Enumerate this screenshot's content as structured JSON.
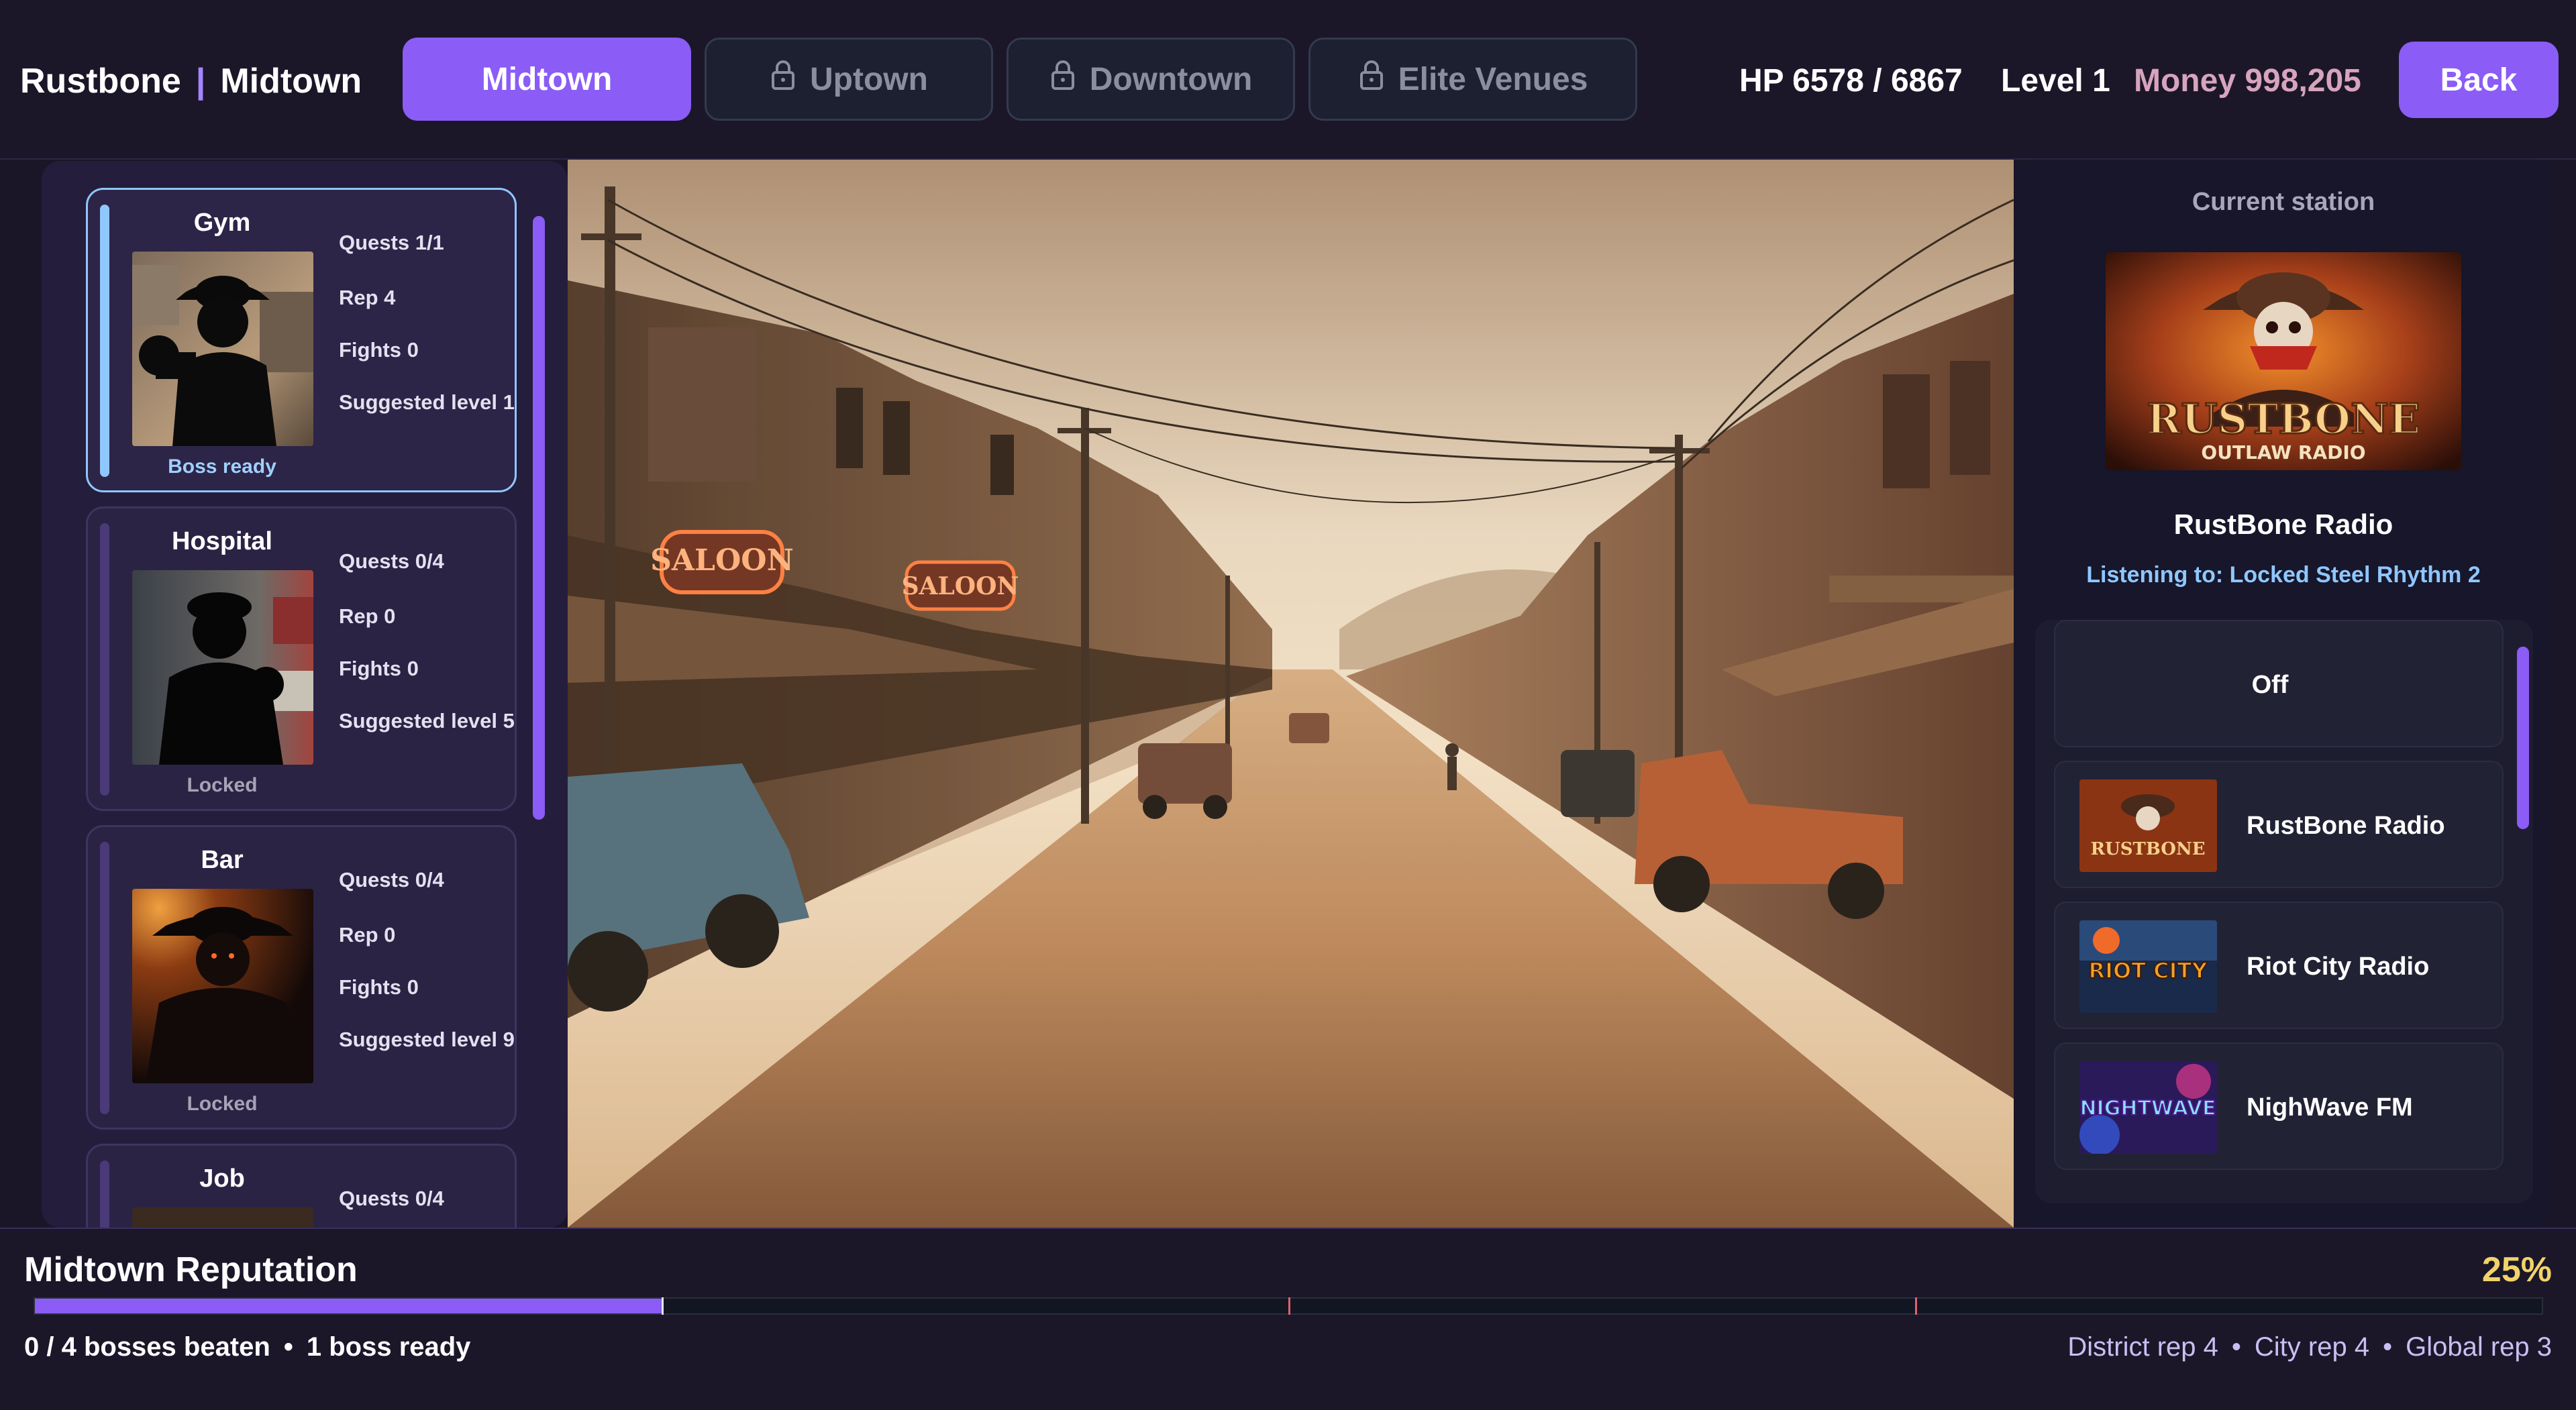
{
  "header": {
    "city": "Rustbone",
    "separator": "|",
    "district": "Midtown",
    "tabs": [
      {
        "label": "Midtown",
        "locked": false
      },
      {
        "label": "Uptown",
        "locked": true
      },
      {
        "label": "Downtown",
        "locked": true
      },
      {
        "label": "Elite Venues",
        "locked": true
      }
    ],
    "hp": "HP 6578 / 6867",
    "level": "Level 1",
    "money": "Money 998,205",
    "back_label": "Back"
  },
  "locations": [
    {
      "name": "Gym",
      "quests": "Quests 1/1",
      "rep": "Rep 4",
      "fights": "Fights 0",
      "suggested": "Suggested level 1",
      "status": "Boss ready",
      "selected": true
    },
    {
      "name": "Hospital",
      "quests": "Quests 0/4",
      "rep": "Rep 0",
      "fights": "Fights 0",
      "suggested": "Suggested level 5",
      "status": "Locked",
      "selected": false
    },
    {
      "name": "Bar",
      "quests": "Quests 0/4",
      "rep": "Rep 0",
      "fights": "Fights 0",
      "suggested": "Suggested level 9",
      "status": "Locked",
      "selected": false
    },
    {
      "name": "Job",
      "quests": "Quests 0/4",
      "rep": "",
      "fights": "",
      "suggested": "",
      "status": "",
      "selected": false
    }
  ],
  "radio": {
    "heading": "Current station",
    "current_station": "RustBone Radio",
    "listening": "Listening to: Locked Steel Rhythm 2",
    "art_text": {
      "rustbone": "RUSTBONE",
      "outlaw": "OUTLAW RADIO",
      "riot": "RIOT CITY",
      "nightwave": "NIGHTWAVE"
    },
    "stations": [
      {
        "label": "Off"
      },
      {
        "label": "RustBone Radio"
      },
      {
        "label": "Riot City Radio"
      },
      {
        "label": "NighWave FM"
      }
    ]
  },
  "scene": {
    "signs": [
      "SALOON",
      "SALOON"
    ]
  },
  "reputation": {
    "title": "Midtown Reputation",
    "percent_label": "25%",
    "progress": 0.25,
    "bosses": "0 / 4 bosses beaten",
    "boss_ready": "1 boss ready",
    "bullet": "•",
    "district_rep": "District rep 4",
    "city_rep": "City rep 4",
    "global_rep": "Global rep 3"
  },
  "colors": {
    "accent": "#8b5cf6",
    "selected_outline": "#8fc7ff",
    "money": "#d7a3bd",
    "percent": "#f2d36b"
  }
}
